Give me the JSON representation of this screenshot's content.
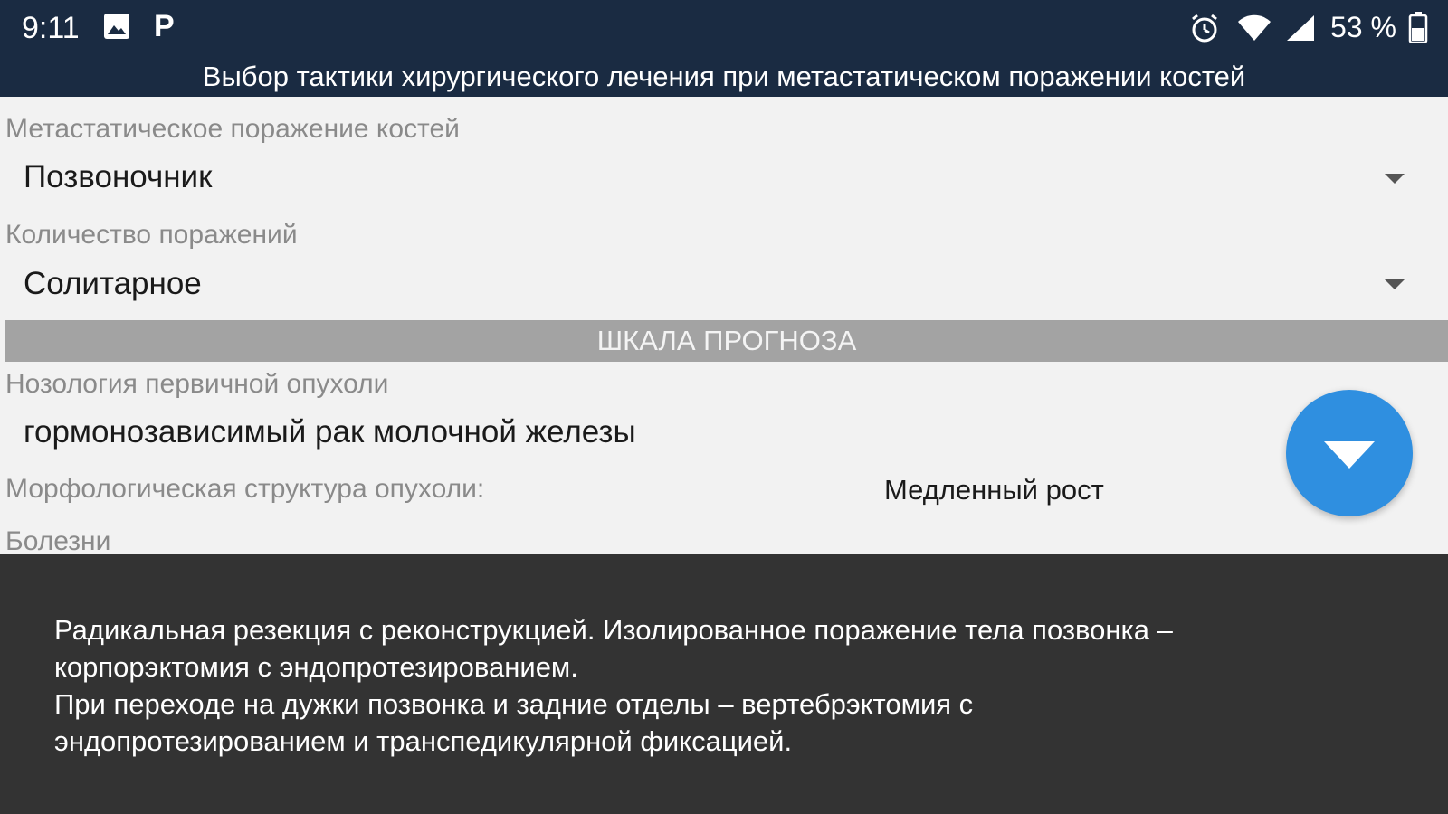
{
  "status_bar": {
    "time": "9:11",
    "battery": "53 %",
    "icons": [
      "gallery-icon",
      "p-icon",
      "alarm-icon",
      "wifi-icon",
      "signal-icon",
      "battery-icon"
    ],
    "p_letter": "P"
  },
  "title": "Выбор тактики хирургического лечения при метастатическом поражении костей",
  "fields": {
    "lesion_site": {
      "label": "Метастатическое поражение костей",
      "value": "Позвоночник"
    },
    "lesion_count": {
      "label": "Количество поражений",
      "value": "Солитарное"
    },
    "nosology": {
      "label": "Нозология первичной опухоли",
      "value": "гормонозависимый рак молочной железы"
    },
    "morphology": {
      "label": "Морфологическая структура опухоли:",
      "value": "Медленный рост"
    },
    "diseases": {
      "label": "Болезни"
    }
  },
  "section": {
    "prognosis_header": "ШКАЛА ПРОГНОЗА"
  },
  "result": {
    "text": "Радикальная резекция с реконструкцией. Изолированное поражение тела позвонка –\nкорпорэктомия с эндопротезированием.\n При переходе на дужки позвонка и задние отделы – вертебрэктомия с\nэндопротезированием и транспедикулярной фиксацией."
  },
  "colors": {
    "header_bg": "#1a2b42",
    "content_bg": "#f2f2f2",
    "section_bg": "#a3a3a3",
    "fab": "#2f8fe0",
    "result_bg": "#333333"
  }
}
